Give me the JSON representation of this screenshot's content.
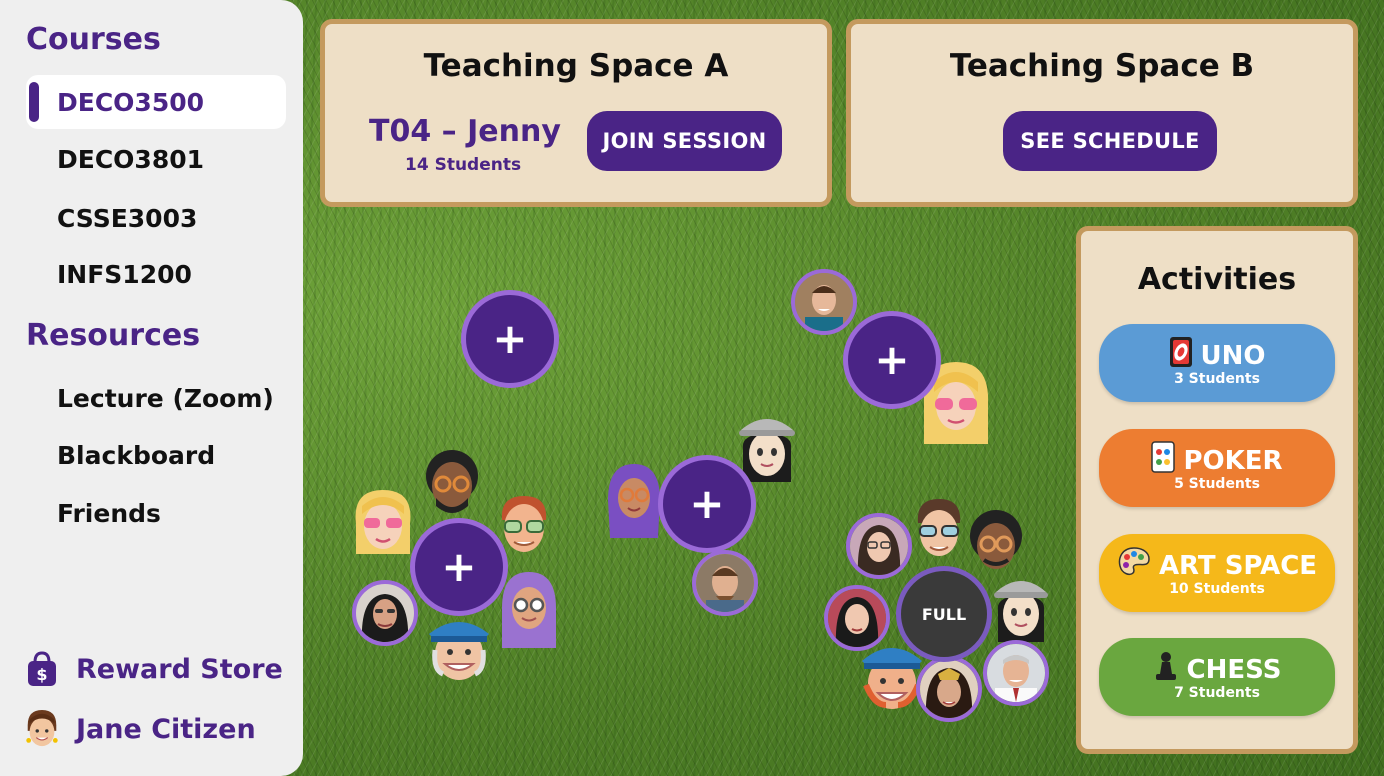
{
  "sidebar": {
    "courses_title": "Courses",
    "courses": [
      {
        "label": "DECO3500",
        "active": true
      },
      {
        "label": "DECO3801",
        "active": false
      },
      {
        "label": "CSSE3003",
        "active": false
      },
      {
        "label": "INFS1200",
        "active": false
      }
    ],
    "resources_title": "Resources",
    "resources": [
      {
        "label": "Lecture (Zoom)"
      },
      {
        "label": "Blackboard"
      },
      {
        "label": "Friends"
      }
    ],
    "reward_store": {
      "label": "Reward Store",
      "icon": "shopping-bag-dollar-icon"
    },
    "user": {
      "name": "Jane Citizen",
      "icon": "memoji-avatar"
    },
    "accent": "#4a2486"
  },
  "space_a": {
    "title": "Teaching Space A",
    "tutorial": "T04 – Jenny",
    "students": "14 Students",
    "button": "JOIN SESSION"
  },
  "space_b": {
    "title": "Teaching Space B",
    "button": "SEE SCHEDULE"
  },
  "activities": {
    "title": "Activities",
    "items": [
      {
        "name": "UNO",
        "count": "3 Students",
        "color": "#5b9bd5",
        "icon": "uno-card-icon"
      },
      {
        "name": "POKER",
        "count": "5 Students",
        "color": "#ed7d31",
        "icon": "playing-card-icon"
      },
      {
        "name": "ART SPACE",
        "count": "10 Students",
        "color": "#f5b81a",
        "icon": "palette-icon"
      },
      {
        "name": "CHESS",
        "count": "7 Students",
        "color": "#6aa73f",
        "icon": "chess-pawn-icon"
      }
    ]
  },
  "circles": {
    "plus_label": "+",
    "full_label": "FULL"
  }
}
